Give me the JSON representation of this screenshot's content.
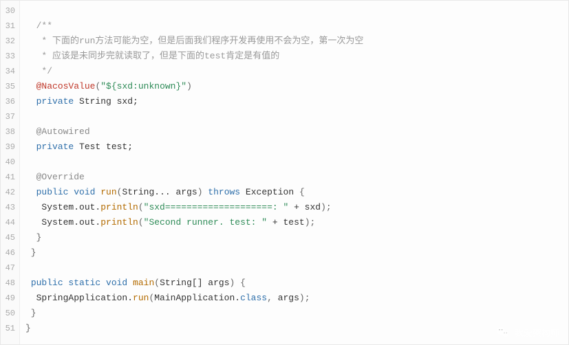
{
  "watermark": {
    "text": "我爱架构师"
  },
  "gutter": {
    "start": 30,
    "end": 51
  },
  "lines": [
    {
      "n": 30,
      "tokens": []
    },
    {
      "n": 31,
      "tokens": [
        {
          "c": "tok-comment",
          "t": "  /**"
        }
      ]
    },
    {
      "n": 32,
      "tokens": [
        {
          "c": "tok-comment",
          "t": "   * 下面的run方法可能为空，但是后面我们程序开发再使用不会为空，第一次为空"
        }
      ]
    },
    {
      "n": 33,
      "tokens": [
        {
          "c": "tok-comment",
          "t": "   * 应该是未同步完就读取了，但是下面的test肯定是有值的"
        }
      ]
    },
    {
      "n": 34,
      "tokens": [
        {
          "c": "tok-comment",
          "t": "   */"
        }
      ]
    },
    {
      "n": 35,
      "tokens": [
        {
          "c": "tok-identifier",
          "t": "  "
        },
        {
          "c": "tok-annotation-red",
          "t": "@NacosValue"
        },
        {
          "c": "tok-punct",
          "t": "("
        },
        {
          "c": "tok-string",
          "t": "\"${sxd:unknown}\""
        },
        {
          "c": "tok-punct",
          "t": ")"
        }
      ]
    },
    {
      "n": 36,
      "tokens": [
        {
          "c": "tok-identifier",
          "t": "  "
        },
        {
          "c": "tok-keyword",
          "t": "private"
        },
        {
          "c": "tok-identifier",
          "t": " String sxd;"
        }
      ]
    },
    {
      "n": 37,
      "tokens": []
    },
    {
      "n": 38,
      "tokens": [
        {
          "c": "tok-identifier",
          "t": "  "
        },
        {
          "c": "tok-annotation",
          "t": "@Autowired"
        }
      ]
    },
    {
      "n": 39,
      "tokens": [
        {
          "c": "tok-identifier",
          "t": "  "
        },
        {
          "c": "tok-keyword",
          "t": "private"
        },
        {
          "c": "tok-identifier",
          "t": " Test test;"
        }
      ]
    },
    {
      "n": 40,
      "tokens": []
    },
    {
      "n": 41,
      "tokens": [
        {
          "c": "tok-identifier",
          "t": "  "
        },
        {
          "c": "tok-annotation",
          "t": "@Override"
        }
      ]
    },
    {
      "n": 42,
      "tokens": [
        {
          "c": "tok-identifier",
          "t": "  "
        },
        {
          "c": "tok-keyword",
          "t": "public void"
        },
        {
          "c": "tok-identifier",
          "t": " "
        },
        {
          "c": "tok-method",
          "t": "run"
        },
        {
          "c": "tok-punct",
          "t": "("
        },
        {
          "c": "tok-identifier",
          "t": "String... args"
        },
        {
          "c": "tok-punct",
          "t": ") "
        },
        {
          "c": "tok-keyword",
          "t": "throws"
        },
        {
          "c": "tok-identifier",
          "t": " Exception "
        },
        {
          "c": "tok-punct",
          "t": "{"
        }
      ]
    },
    {
      "n": 43,
      "tokens": [
        {
          "c": "tok-identifier",
          "t": "   System.out."
        },
        {
          "c": "tok-method",
          "t": "println"
        },
        {
          "c": "tok-punct",
          "t": "("
        },
        {
          "c": "tok-string",
          "t": "\"sxd====================: \""
        },
        {
          "c": "tok-identifier",
          "t": " + sxd"
        },
        {
          "c": "tok-punct",
          "t": ");"
        }
      ]
    },
    {
      "n": 44,
      "tokens": [
        {
          "c": "tok-identifier",
          "t": "   System.out."
        },
        {
          "c": "tok-method",
          "t": "println"
        },
        {
          "c": "tok-punct",
          "t": "("
        },
        {
          "c": "tok-string",
          "t": "\"Second runner. test: \""
        },
        {
          "c": "tok-identifier",
          "t": " + test"
        },
        {
          "c": "tok-punct",
          "t": ");"
        }
      ]
    },
    {
      "n": 45,
      "tokens": [
        {
          "c": "tok-punct",
          "t": "  }"
        }
      ]
    },
    {
      "n": 46,
      "tokens": [
        {
          "c": "tok-punct",
          "t": " }"
        }
      ]
    },
    {
      "n": 47,
      "tokens": []
    },
    {
      "n": 48,
      "tokens": [
        {
          "c": "tok-identifier",
          "t": " "
        },
        {
          "c": "tok-keyword",
          "t": "public static void"
        },
        {
          "c": "tok-identifier",
          "t": " "
        },
        {
          "c": "tok-method",
          "t": "main"
        },
        {
          "c": "tok-punct",
          "t": "("
        },
        {
          "c": "tok-identifier",
          "t": "String[] args"
        },
        {
          "c": "tok-punct",
          "t": ") {"
        }
      ]
    },
    {
      "n": 49,
      "tokens": [
        {
          "c": "tok-identifier",
          "t": "  SpringApplication."
        },
        {
          "c": "tok-method",
          "t": "run"
        },
        {
          "c": "tok-punct",
          "t": "("
        },
        {
          "c": "tok-identifier",
          "t": "MainApplication."
        },
        {
          "c": "tok-keyword",
          "t": "class"
        },
        {
          "c": "tok-punct",
          "t": ", "
        },
        {
          "c": "tok-identifier",
          "t": "args"
        },
        {
          "c": "tok-punct",
          "t": ");"
        }
      ]
    },
    {
      "n": 50,
      "tokens": [
        {
          "c": "tok-punct",
          "t": " }"
        }
      ]
    },
    {
      "n": 51,
      "tokens": [
        {
          "c": "tok-punct",
          "t": "}"
        }
      ]
    }
  ]
}
